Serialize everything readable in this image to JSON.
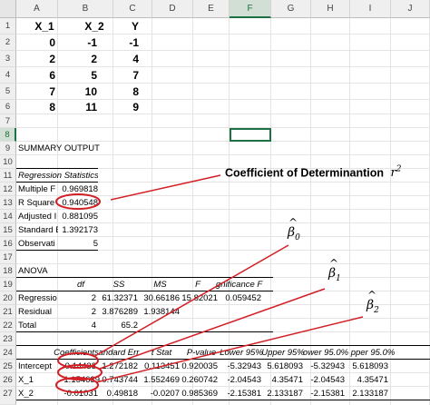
{
  "columns": [
    "A",
    "B",
    "C",
    "D",
    "E",
    "F",
    "G",
    "H",
    "I",
    "J"
  ],
  "rows": [
    "1",
    "2",
    "3",
    "4",
    "5",
    "6",
    "7",
    "8",
    "9",
    "10",
    "11",
    "12",
    "13",
    "14",
    "15",
    "16",
    "17",
    "18",
    "19",
    "20",
    "21",
    "22",
    "23",
    "24",
    "25",
    "26",
    "27"
  ],
  "selected_column": "F",
  "selected_row": "8",
  "data_table": {
    "headers": [
      "X_1",
      "X_2",
      "Y"
    ],
    "rows": [
      [
        "0",
        "-1",
        "-1"
      ],
      [
        "2",
        "2",
        "4"
      ],
      [
        "6",
        "5",
        "7"
      ],
      [
        "7",
        "10",
        "8"
      ],
      [
        "8",
        "11",
        "9"
      ]
    ]
  },
  "summary_title": "SUMMARY OUTPUT",
  "regression_stats": {
    "header": "Regression Statistics",
    "rows": [
      {
        "label": "Multiple F",
        "value": "0.969818"
      },
      {
        "label": "R Square",
        "value": "0.940548"
      },
      {
        "label": "Adjusted I",
        "value": "0.881095"
      },
      {
        "label": "Standard E",
        "value": "1.392173"
      },
      {
        "label": "Observati",
        "value": "5"
      }
    ]
  },
  "anova": {
    "title": "ANOVA",
    "headers": [
      "df",
      "SS",
      "MS",
      "F",
      "gnificance F"
    ],
    "rows": [
      {
        "label": "Regressio",
        "df": "2",
        "ss": "61.32371",
        "ms": "30.66186",
        "f": "15.82021",
        "sig": "0.059452"
      },
      {
        "label": "Residual",
        "df": "2",
        "ss": "3.876289",
        "ms": "1.938144",
        "f": "",
        "sig": ""
      },
      {
        "label": "Total",
        "df": "4",
        "ss": "65.2",
        "ms": "",
        "f": "",
        "sig": ""
      }
    ]
  },
  "coefficients": {
    "headers": [
      "Coefficients",
      "andard Err",
      "t Stat",
      "P-value",
      "Lower 95%",
      "Upper 95%",
      "ower 95.0%",
      "pper 95.0%"
    ],
    "rows": [
      {
        "label": "Intercept",
        "values": [
          "0.14433",
          "1.272182",
          "0.113451",
          "0.920035",
          "-5.32943",
          "5.618093",
          "-5.32943",
          "5.618093"
        ]
      },
      {
        "label": "X_1",
        "values": [
          "1.154639",
          "0.743744",
          "1.552469",
          "0.260742",
          "-2.04543",
          "4.35471",
          "-2.04543",
          "4.35471"
        ]
      },
      {
        "label": "X_2",
        "values": [
          "-0.01031",
          "0.49818",
          "-0.0207",
          "0.985369",
          "-2.15381",
          "2.133187",
          "-2.15381",
          "2.133187"
        ]
      }
    ]
  },
  "annotations": {
    "r2_label": "Coefficient of Determinantion",
    "r2_symbol": "r",
    "r2_exp": "2",
    "beta0": "β",
    "beta0_sub": "0",
    "beta1": "β",
    "beta1_sub": "1",
    "beta2": "β",
    "beta2_sub": "2",
    "hat": "^",
    "color": "#d21f26"
  }
}
